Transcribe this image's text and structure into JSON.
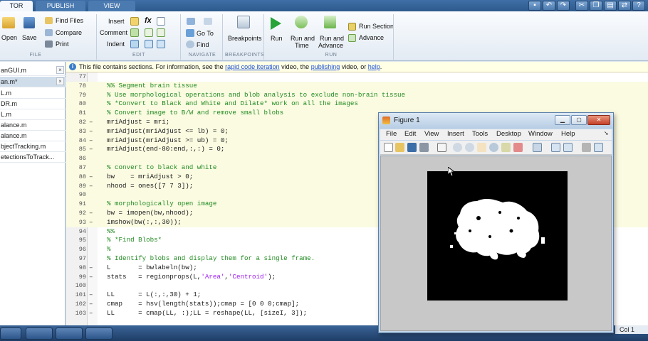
{
  "ribbon": {
    "tabs": [
      "TOR",
      "PUBLISH",
      "VIEW"
    ],
    "file_group": {
      "open": "Open",
      "save": "Save",
      "find_files": "Find Files",
      "compare": "Compare",
      "print": "Print",
      "label": "FILE"
    },
    "edit_group": {
      "insert": "Insert",
      "comment": "Comment",
      "indent": "Indent",
      "label": "EDIT"
    },
    "navigate_group": {
      "go_to": "Go To",
      "find": "Find",
      "label": "NAVIGATE"
    },
    "breakpoints_group": {
      "breakpoints": "Breakpoints",
      "label": "BREAKPOINTS"
    },
    "run_group": {
      "run": "Run",
      "run_and_time_1": "Run and",
      "run_and_time_2": "Time",
      "run_and_advance_1": "Run and",
      "run_and_advance_2": "Advance",
      "run_section": "Run Section",
      "advance": "Advance",
      "label": "RUN"
    }
  },
  "files": [
    "anGUI.m",
    "an.m*",
    "L.m",
    "DR.m",
    "L.m",
    "alance.m",
    "alance.m",
    "bjectTracking.m",
    "etectionsToTrack..."
  ],
  "infobar": {
    "prefix": "This file contains sections. For information, see the ",
    "link1": "rapid code iteration",
    "mid": " video, the ",
    "link2": "publishing",
    "mid2": " video, or ",
    "link3": "help",
    "suffix": "."
  },
  "code_lines": [
    {
      "no": "77",
      "dash": "",
      "parts": [],
      "sec": false
    },
    {
      "no": "78",
      "dash": "",
      "parts": [
        [
          "c",
          "%% Segment brain tissue"
        ]
      ],
      "sec": true
    },
    {
      "no": "79",
      "dash": "",
      "parts": [
        [
          "c",
          "% Use morphological operations and blob analysis to exclude non-brain tissue"
        ]
      ],
      "sec": true
    },
    {
      "no": "80",
      "dash": "",
      "parts": [
        [
          "c",
          "% *Convert to Black and White and Dilate* work on all the images"
        ]
      ],
      "sec": true
    },
    {
      "no": "81",
      "dash": "",
      "parts": [
        [
          "c",
          "% Convert image to B/W and remove small blobs"
        ]
      ],
      "sec": true
    },
    {
      "no": "82",
      "dash": "–",
      "parts": [
        [
          "n",
          "mriAdjust = mri;"
        ]
      ],
      "sec": true
    },
    {
      "no": "83",
      "dash": "–",
      "parts": [
        [
          "n",
          "mriAdjust(mriAdjust <= lb) = 0;"
        ]
      ],
      "sec": true
    },
    {
      "no": "84",
      "dash": "–",
      "parts": [
        [
          "n",
          "mriAdjust(mriAdjust >= ub) = 0;"
        ]
      ],
      "sec": true
    },
    {
      "no": "85",
      "dash": "–",
      "parts": [
        [
          "n",
          "mriAdjust(end-80:end,:,:) = 0;"
        ]
      ],
      "sec": true
    },
    {
      "no": "86",
      "dash": "",
      "parts": [],
      "sec": true
    },
    {
      "no": "87",
      "dash": "",
      "parts": [
        [
          "c",
          "% convert to black and white"
        ]
      ],
      "sec": true
    },
    {
      "no": "88",
      "dash": "–",
      "parts": [
        [
          "n",
          "bw    = mriAdjust > 0;"
        ]
      ],
      "sec": true
    },
    {
      "no": "89",
      "dash": "–",
      "parts": [
        [
          "n",
          "nhood = ones([7 7 3]);"
        ]
      ],
      "sec": true
    },
    {
      "no": "90",
      "dash": "",
      "parts": [],
      "sec": true
    },
    {
      "no": "91",
      "dash": "",
      "parts": [
        [
          "c",
          "% morphologically open image"
        ]
      ],
      "sec": true
    },
    {
      "no": "92",
      "dash": "–",
      "parts": [
        [
          "n",
          "bw = imopen(bw,nhood);"
        ]
      ],
      "sec": true
    },
    {
      "no": "93",
      "dash": "–",
      "parts": [
        [
          "n",
          "imshow(bw(:,:,30));"
        ]
      ],
      "sec": true
    },
    {
      "no": "94",
      "dash": "",
      "parts": [
        [
          "c",
          "%%"
        ]
      ],
      "sec": false
    },
    {
      "no": "95",
      "dash": "",
      "parts": [
        [
          "c",
          "% *Find Blobs*"
        ]
      ],
      "sec": false
    },
    {
      "no": "96",
      "dash": "",
      "parts": [
        [
          "c",
          "%"
        ]
      ],
      "sec": false
    },
    {
      "no": "97",
      "dash": "",
      "parts": [
        [
          "c",
          "% Identify blobs and display them for a single frame."
        ]
      ],
      "sec": false
    },
    {
      "no": "98",
      "dash": "–",
      "parts": [
        [
          "n",
          "L       = bwlabeln(bw);"
        ]
      ],
      "sec": false
    },
    {
      "no": "99",
      "dash": "–",
      "parts": [
        [
          "n",
          "stats   = regionprops(L,"
        ],
        [
          "s",
          "'Area'"
        ],
        [
          "n",
          ","
        ],
        [
          "s",
          "'Centroid'"
        ],
        [
          "n",
          ");"
        ]
      ],
      "sec": false
    },
    {
      "no": "100",
      "dash": "",
      "parts": [],
      "sec": false
    },
    {
      "no": "101",
      "dash": "–",
      "parts": [
        [
          "n",
          "LL      = L(:,:,30) + 1;"
        ]
      ],
      "sec": false
    },
    {
      "no": "102",
      "dash": "–",
      "parts": [
        [
          "n",
          "cmap    = hsv(length(stats));cmap = [0 0 0;cmap];"
        ]
      ],
      "sec": false
    },
    {
      "no": "103",
      "dash": "–",
      "parts": [
        [
          "n",
          "LL      = cmap(LL, :);LL = reshape(LL, [sizeI, 3]);"
        ]
      ],
      "sec": false
    }
  ],
  "figure": {
    "title": "Figure 1",
    "menu": [
      "File",
      "Edit",
      "View",
      "Insert",
      "Tools",
      "Desktop",
      "Window",
      "Help"
    ]
  },
  "status": {
    "col": "Col 1"
  }
}
